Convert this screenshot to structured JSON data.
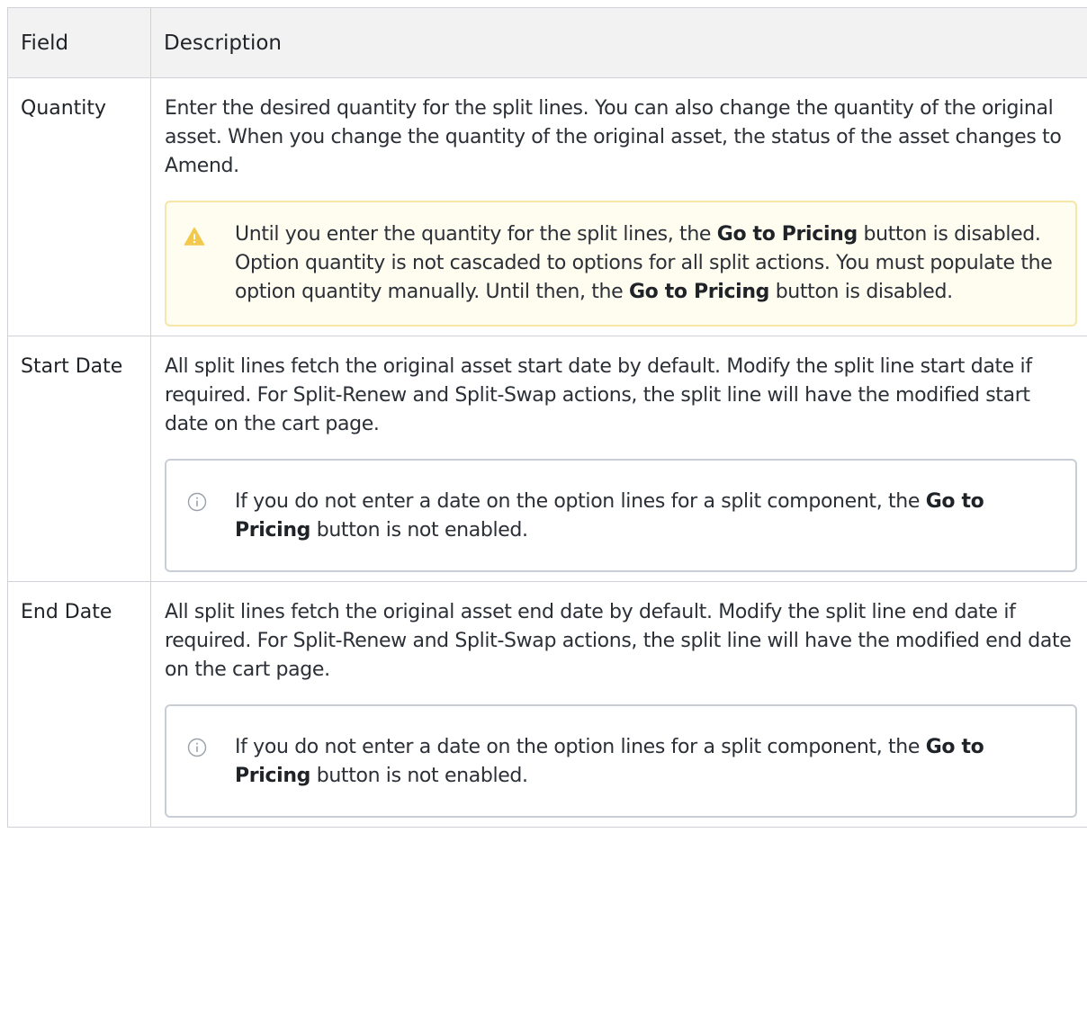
{
  "table": {
    "headers": {
      "field": "Field",
      "description": "Description"
    },
    "rows": [
      {
        "field": "Quantity",
        "description": "Enter the desired quantity for the split lines. You can also change the quantity of the original asset. When you change the quantity of the original asset, the status of the asset changes to Amend.",
        "callout": {
          "type": "warning",
          "icon": "warning-icon",
          "line1_pre": "Until you enter the quantity for the split lines, the ",
          "line1_bold": "Go to Pricing",
          "line1_post": " button is disabled.",
          "line2_pre": "Option quantity is not cascaded to options for all split actions. You must populate the option quantity manually. Until then, the ",
          "line2_bold": "Go to Pricing",
          "line2_post": " button is disabled."
        }
      },
      {
        "field": "Start Date",
        "description": "All split lines fetch the original asset start date by default. Modify the split line start date if required. For Split-Renew and Split-Swap actions, the split line will have the modified start date on the cart page.",
        "callout": {
          "type": "info",
          "icon": "info-icon",
          "text_pre": "If you do not enter a date on the option lines for a split component, the ",
          "text_bold": "Go to Pricing",
          "text_post": " button is not enabled."
        }
      },
      {
        "field": "End Date",
        "description": "All split lines fetch the original asset end date by default. Modify the split line end date if required. For Split-Renew and Split-Swap actions, the split line will have the modified end date on the cart page.",
        "callout": {
          "type": "info",
          "icon": "info-icon",
          "text_pre": "If you do not enter a date on the option lines for a split component, the ",
          "text_bold": "Go to Pricing",
          "text_post": " button is not enabled."
        }
      }
    ]
  },
  "colors": {
    "warning_bg": "#fffcf0",
    "warning_border": "#f6e6a8",
    "warning_icon": "#f2c94c",
    "info_border": "#c9ced6",
    "header_bg": "#f2f2f2"
  }
}
